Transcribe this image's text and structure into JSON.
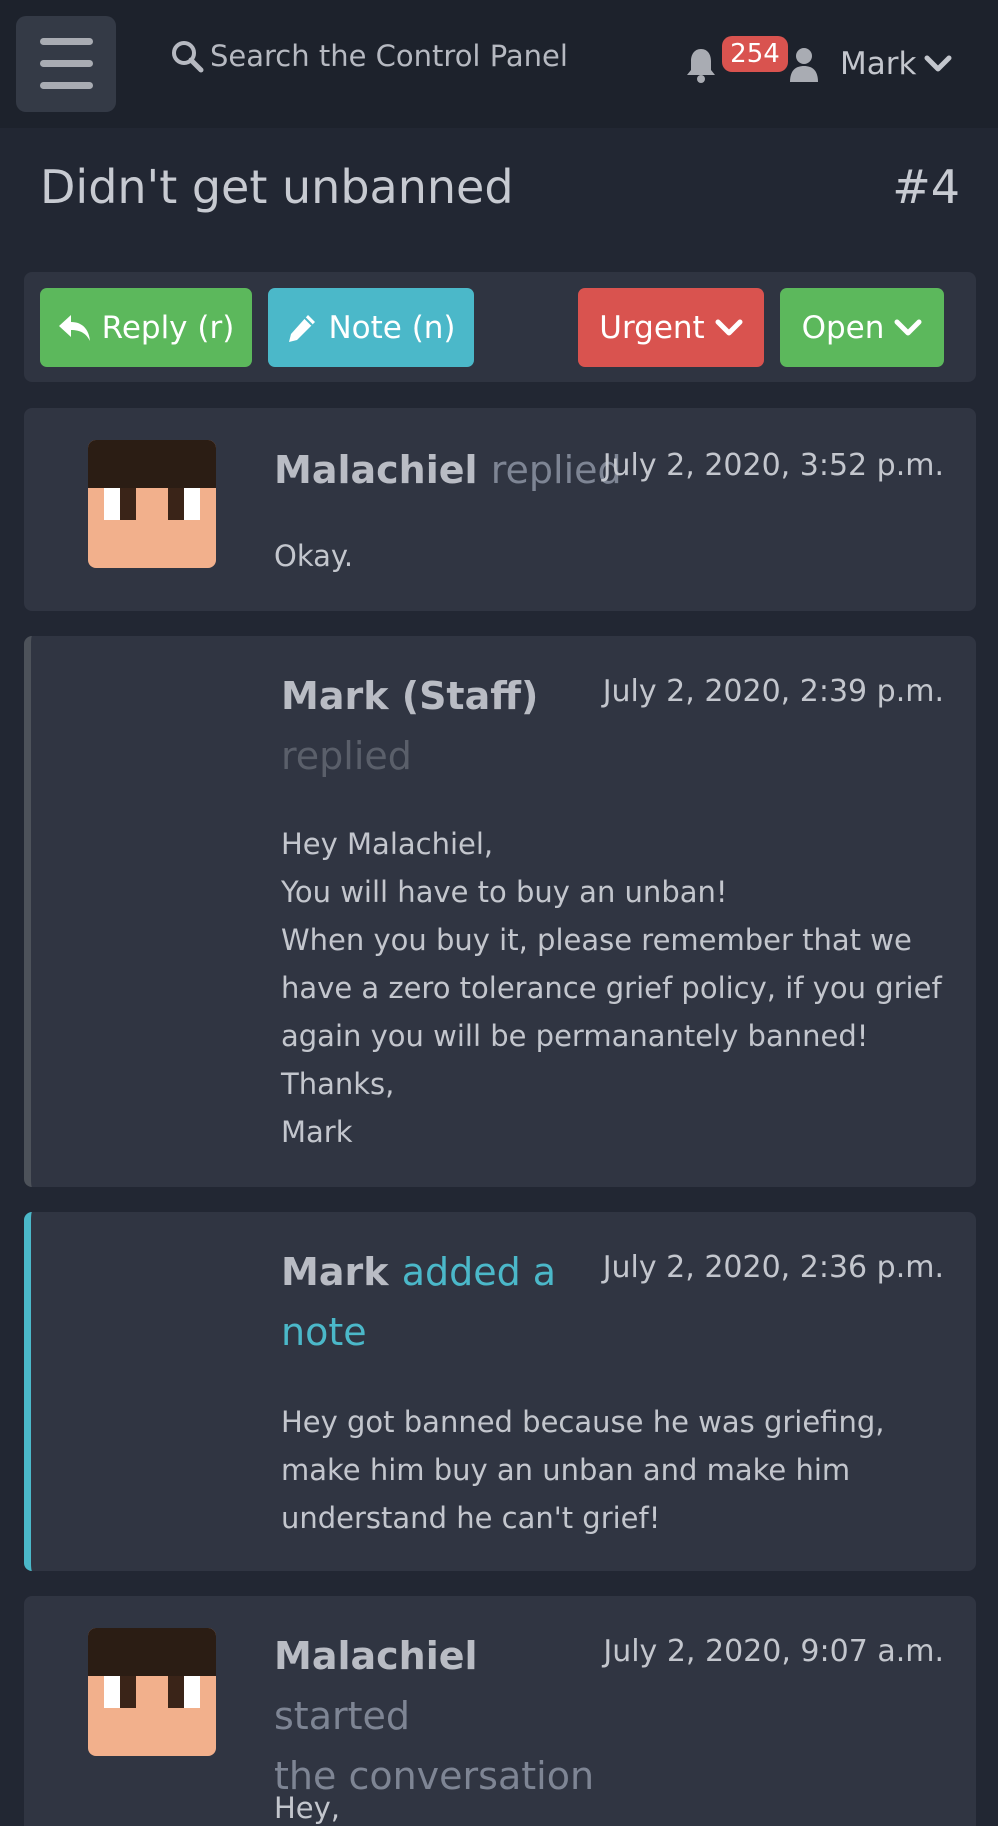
{
  "header": {
    "search_placeholder": "Search the Control Panel",
    "notification_count": "254",
    "user_name": "Mark"
  },
  "ticket": {
    "title": "Didn't get unbanned",
    "number": "#4"
  },
  "actions": {
    "reply_label": "Reply (r)",
    "note_label": "Note (n)",
    "priority_label": "Urgent",
    "status_label": "Open"
  },
  "messages": [
    {
      "author": "Malachiel",
      "action": "replied",
      "time": "July 2, 2020, 3:52 p.m.",
      "lines": [
        "Okay."
      ]
    },
    {
      "author": "Mark (Staff)",
      "action": "replied",
      "time": "July 2, 2020, 2:39 p.m.",
      "lines": [
        "Hey Malachiel,",
        "You will have to buy an unban!",
        "When you buy it, please remember that we",
        "have a zero tolerance grief policy, if you grief",
        "again you will be permanantely banned!",
        "Thanks,",
        "Mark"
      ]
    },
    {
      "author": "Mark",
      "action_line1": "added a",
      "action_line2": "note",
      "time": "July 2, 2020, 2:36 p.m.",
      "lines": [
        "Hey got banned because he was griefing,",
        "make him buy an unban and make him",
        "understand he can't grief!"
      ]
    },
    {
      "author": "Malachiel",
      "action_line1": "started",
      "action_line2": "the conversation",
      "time": "July 2, 2020, 9:07 a.m.",
      "lines": [
        "Hey,"
      ]
    }
  ],
  "colors": {
    "success": "#5cb85c",
    "info": "#4bb8c9",
    "danger": "#d9534f"
  }
}
